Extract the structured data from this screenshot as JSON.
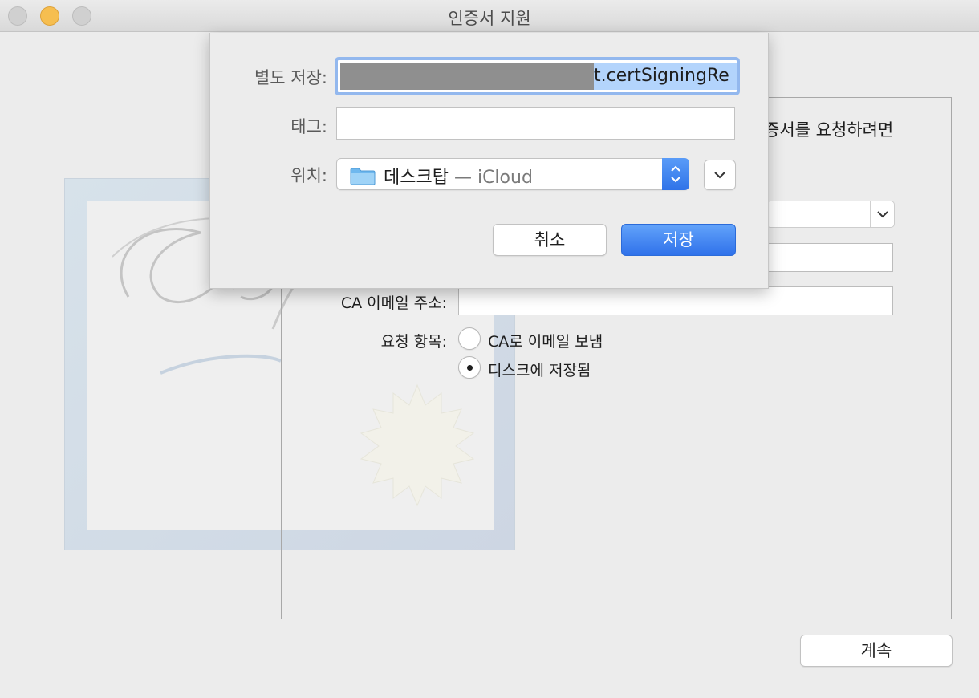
{
  "window": {
    "title": "인증서 지원"
  },
  "main": {
    "intro_text": "증서를 요청하려면",
    "ca_email_label": "CA 이메일 주소:",
    "ca_email_value": "",
    "request_label": "요청 항목:",
    "options": [
      {
        "label": "CA로 이메일 보냄",
        "selected": false
      },
      {
        "label": "디스크에 저장됨",
        "selected": true
      }
    ],
    "continue_label": "계속"
  },
  "sheet": {
    "save_as_label": "별도 저장:",
    "filename_visible": "t.certSigningRe",
    "tags_label": "태그:",
    "tags_value": "",
    "where_label": "위치:",
    "location_name": "데스크탑",
    "location_sub": " — iCloud",
    "cancel_label": "취소",
    "save_label": "저장"
  },
  "colors": {
    "accent": "#2f71ea",
    "selection": "#b3d4fc",
    "focus_ring": "#93b8ee"
  }
}
